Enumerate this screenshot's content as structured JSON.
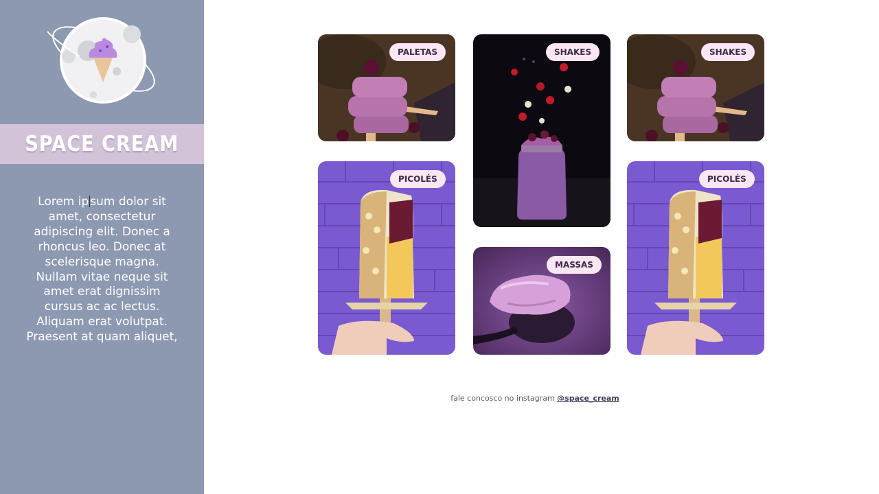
{
  "sidebar": {
    "title": "SPACE CREAM",
    "description_before": "Lorem ip",
    "description_after": "sum dolor sit amet, consectetur adipiscing elit. Donec a rhoncus leo. Donec at scelerisque magna. Nullam vitae neque sit amet erat dignissim cursus ac ac lectus. Aliquam erat volutpat. Praesent at quam aliquet,"
  },
  "gallery": {
    "cards": [
      {
        "tag": "PALETAS",
        "image": "popsicle-stack-photo"
      },
      {
        "tag": "SHAKES",
        "image": "berry-shake-jar-photo"
      },
      {
        "tag": "SHAKES",
        "image": "popsicle-stack-photo"
      },
      {
        "tag": "PICOLÉS",
        "image": "nut-popsicle-photo"
      },
      {
        "tag": "MASSAS",
        "image": "ice-cream-scoop-photo"
      },
      {
        "tag": "PICOLÉS",
        "image": "nut-popsicle-photo"
      }
    ]
  },
  "footer": {
    "text": "fale concosco no instagram ",
    "link": "@space_cream"
  },
  "colors": {
    "sidebar": "#8c99b1",
    "title_band": "#d3c3d9",
    "tag_bg": "#fbe6f3",
    "purple": "#8d63c9"
  }
}
